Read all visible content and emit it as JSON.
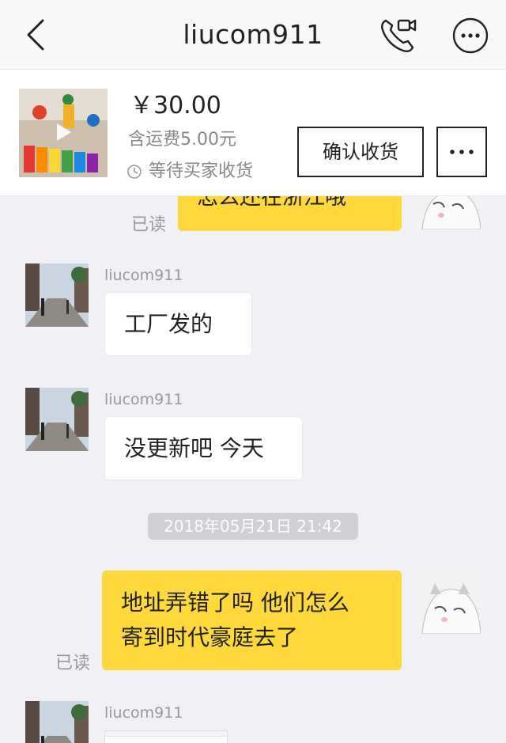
{
  "header": {
    "title": "liucom911"
  },
  "order": {
    "price": "￥30.00",
    "shipping": "含运费5.00元",
    "status": "等待买家收货",
    "confirm_label": "确认收货"
  },
  "chat": {
    "read_label": "已读",
    "timestamp": "2018年05月21日 21:42",
    "messages": [
      {
        "from": "me",
        "text": "怎么还在浙江哦",
        "read": "已读"
      },
      {
        "from": "liucom911",
        "name": "liucom911",
        "text": "工厂发的"
      },
      {
        "from": "liucom911",
        "name": "liucom911",
        "text": "没更新吧 今天"
      },
      {
        "from": "me",
        "text_line1": "地址弄错了吗 他们怎么",
        "text_line2": "寄到时代豪庭去了",
        "read": "已读"
      },
      {
        "from": "liucom911",
        "name": "liucom911"
      }
    ]
  },
  "colors": {
    "outgoing_bubble": "#ffd83b",
    "incoming_bubble": "#ffffff",
    "background": "#f0f0f5"
  },
  "icons": [
    "back-icon",
    "video-call-icon",
    "more-icon",
    "clock-icon"
  ]
}
